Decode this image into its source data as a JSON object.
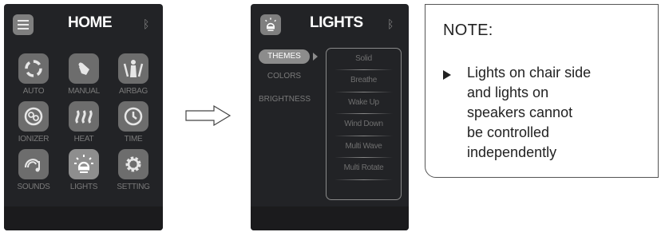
{
  "home_panel": {
    "title": "HOME",
    "tiles": [
      {
        "label": "AUTO",
        "icon": "auto-cycle-icon"
      },
      {
        "label": "MANUAL",
        "icon": "hand-icon"
      },
      {
        "label": "AIRBAG",
        "icon": "airbag-body-icon"
      },
      {
        "label": "IONIZER",
        "icon": "ionizer-icon"
      },
      {
        "label": "HEAT",
        "icon": "heat-waves-icon"
      },
      {
        "label": "TIME",
        "icon": "clock-icon"
      },
      {
        "label": "SOUNDS",
        "icon": "sound-speaker-icon"
      },
      {
        "label": "LIGHTS",
        "icon": "light-bulb-icon"
      },
      {
        "label": "SETTING",
        "icon": "gear-icon"
      }
    ]
  },
  "lights_panel": {
    "title": "LIGHTS",
    "menu": [
      "THEMES",
      "COLORS",
      "BRIGHTNESS"
    ],
    "selected_menu": "THEMES",
    "themes": [
      "Solid",
      "Breathe",
      "Wake Up",
      "Wind Down",
      "Multi Wave",
      "Multi Rotate"
    ]
  },
  "note": {
    "title": "NOTE:",
    "text": "Lights on chair side\nand lights on\nspeakers cannot\nbe controlled\nindependently"
  }
}
